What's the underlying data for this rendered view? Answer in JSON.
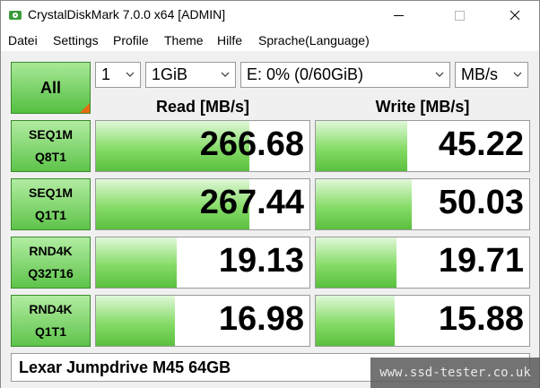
{
  "window": {
    "title": "CrystalDiskMark 7.0.0 x64 [ADMIN]"
  },
  "menu": [
    "Datei",
    "Settings",
    "Profile",
    "Theme",
    "Hilfe",
    "Sprache(Language)"
  ],
  "controls": {
    "all_label": "All",
    "count": "1",
    "size": "1GiB",
    "drive": "E: 0% (0/60GiB)",
    "unit": "MB/s"
  },
  "headers": {
    "read": "Read [MB/s]",
    "write": "Write [MB/s]"
  },
  "tests": [
    {
      "line1": "SEQ1M",
      "line2": "Q8T1",
      "read": "266.68",
      "write": "45.22",
      "read_fill": 0.72,
      "write_fill": 0.43
    },
    {
      "line1": "SEQ1M",
      "line2": "Q1T1",
      "read": "267.44",
      "write": "50.03",
      "read_fill": 0.72,
      "write_fill": 0.45
    },
    {
      "line1": "RND4K",
      "line2": "Q32T16",
      "read": "19.13",
      "write": "19.71",
      "read_fill": 0.38,
      "write_fill": 0.38
    },
    {
      "line1": "RND4K",
      "line2": "Q1T1",
      "read": "16.98",
      "write": "15.88",
      "read_fill": 0.37,
      "write_fill": 0.37
    }
  ],
  "comment": "Lexar Jumpdrive M45 64GB",
  "watermark": "www.ssd-tester.co.uk",
  "colors": {
    "accent_green": "#54c040",
    "corner_orange": "#e86a10"
  }
}
